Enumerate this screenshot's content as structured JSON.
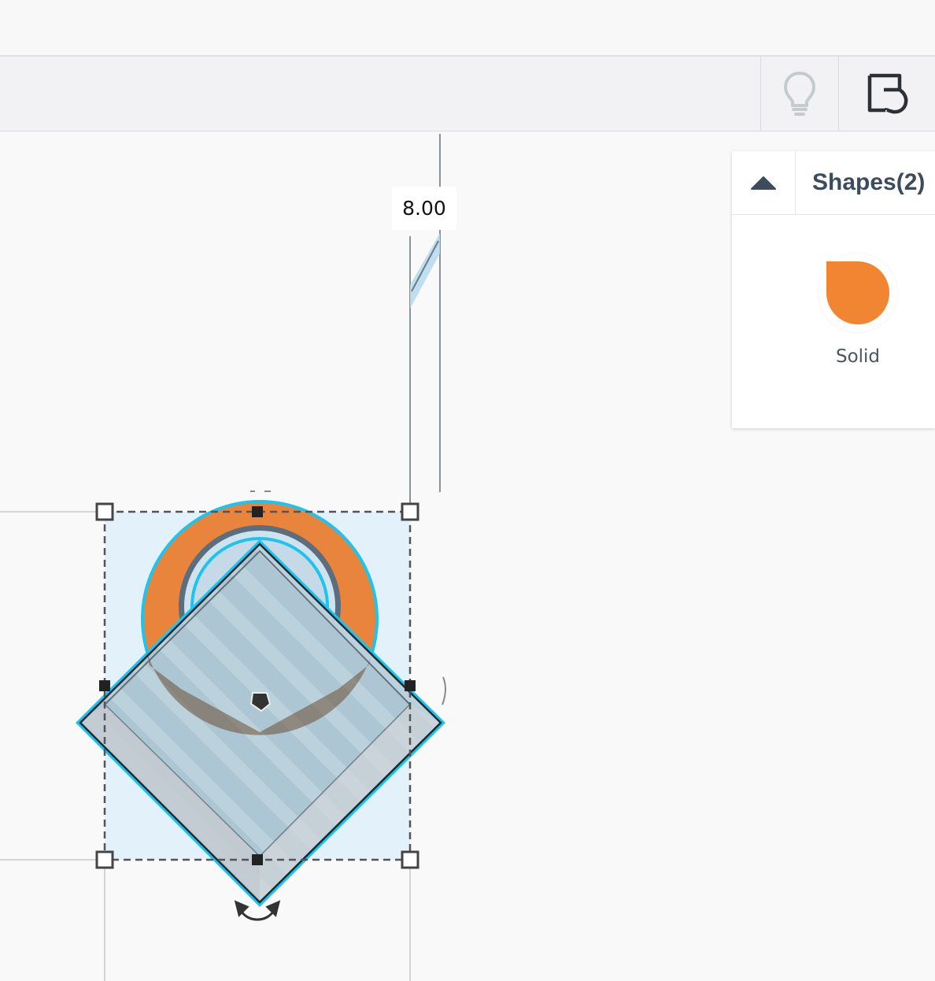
{
  "toolbar": {
    "hint_icon": "lightbulb-icon",
    "note_icon": "note-icon"
  },
  "workplane": {
    "dimension_value": "8.00"
  },
  "shapes_panel": {
    "collapse_icon": "caret-up-icon",
    "title": "Shapes(2)",
    "solid_label": "Solid",
    "solid_color": "#f28532"
  },
  "colors": {
    "selection_blue": "#1fc4ee",
    "hole_gray": "#aab8c6",
    "orange_ring": "#e8843b",
    "panel_title": "#3c4c5c"
  }
}
